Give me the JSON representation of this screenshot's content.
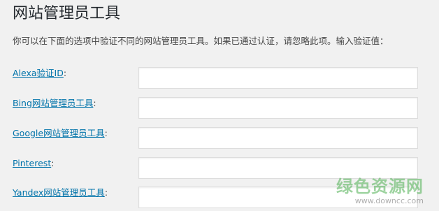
{
  "page": {
    "title": "网站管理员工具",
    "intro": "你可以在下面的选项中验证不同的网站管理员工具。如果已通过认证，请忽略此项。输入验证值："
  },
  "fields": [
    {
      "link": "Alexa验证ID",
      "suffix": ":",
      "value": "",
      "placeholder": ""
    },
    {
      "link": "Bing网站管理员工具",
      "suffix": ":",
      "value": "",
      "placeholder": ""
    },
    {
      "link": "Google网站管理员工具",
      "suffix": ":",
      "value": "",
      "placeholder": ""
    },
    {
      "link": "Pinterest",
      "suffix": ":",
      "value": "",
      "placeholder": ""
    },
    {
      "link": "Yandex网站管理员工具",
      "suffix": ":",
      "value": "",
      "placeholder": ""
    }
  ],
  "watermark": {
    "logo": "绿色资源网",
    "url": "www.downcc.com"
  }
}
